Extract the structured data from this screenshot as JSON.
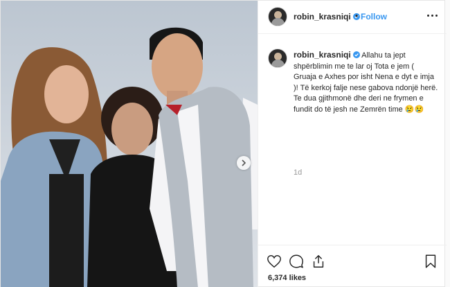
{
  "header": {
    "username": "robin_krasniqi",
    "separator": "•",
    "follow_label": "Follow"
  },
  "caption": {
    "username": "robin_krasniqi",
    "text": "Allahu ta jept shpërblimin me te lar oj Tota e jem ( Gruaja e Axhes por isht Nena e dyt e imja )! Të kerkoj falje nese gabova ndonjë herë. Te dua gjithmonë dhe deri ne frymen e fundit do të jesh ne Zemrën time 😢😢",
    "time": "1d"
  },
  "stats": {
    "likes": "6,374 likes"
  },
  "icons": {
    "verified": "verified-badge-icon",
    "more": "more-options-icon",
    "like": "heart-icon",
    "comment": "comment-icon",
    "share": "share-icon",
    "save": "bookmark-icon",
    "next": "chevron-right-icon"
  },
  "colors": {
    "link_blue": "#3897f0",
    "text": "#262626",
    "muted": "#999999",
    "border": "#efefef"
  }
}
